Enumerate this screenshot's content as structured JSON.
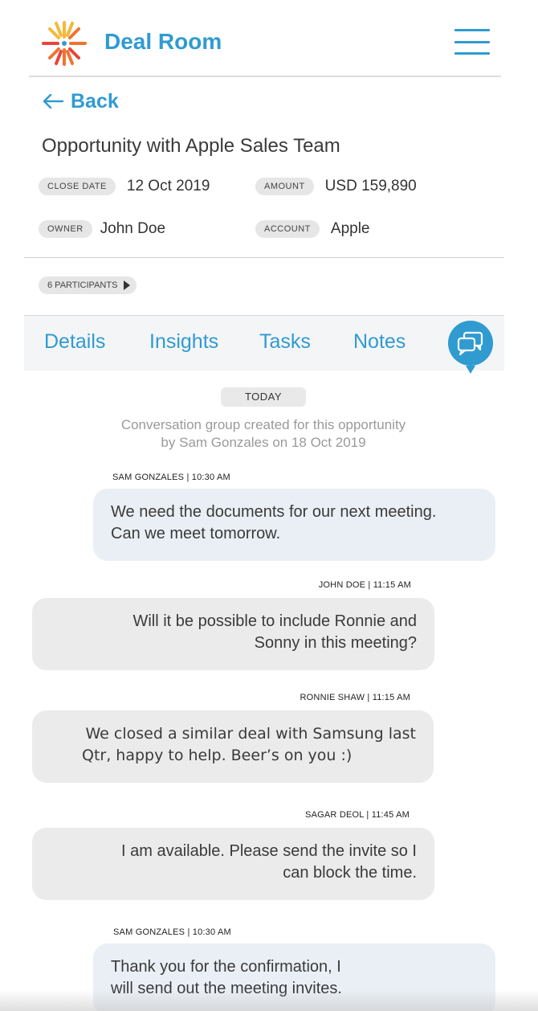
{
  "header": {
    "app_title": "Deal Room"
  },
  "nav": {
    "back_label": "Back"
  },
  "opportunity": {
    "title": "Opportunity with Apple Sales Team",
    "close_date": {
      "label": "CLOSE DATE",
      "value": "12 Oct 2019"
    },
    "amount": {
      "label": "AMOUNT",
      "value": "USD 159,890"
    },
    "owner": {
      "label": "OWNER",
      "value": "John Doe"
    },
    "account": {
      "label": "ACCOUNT",
      "value": "Apple"
    },
    "participants_label": "6 PARTICIPANTS"
  },
  "tabs": [
    {
      "label": "Details"
    },
    {
      "label": "Insights"
    },
    {
      "label": "Tasks"
    },
    {
      "label": "Notes"
    }
  ],
  "chat": {
    "day_label": "TODAY",
    "system_message": {
      "line1": "Conversation group created for this opportunity",
      "line2": "by Sam Gonzales on 18 Oct 2019"
    },
    "messages": [
      {
        "sender": "SAM GONZALES | 10:30 AM",
        "line1": "We need the documents for our next meeting.",
        "line2": "Can we meet tomorrow.",
        "direction": "out"
      },
      {
        "sender": "JOHN DOE | 11:15 AM",
        "line1": "Will it be possible to include Ronnie and",
        "line2": "Sonny in this meeting?",
        "direction": "in"
      },
      {
        "sender": "RONNIE SHAW | 11:15 AM",
        "line1": "We closed a similar deal with Samsung last",
        "line2": "Qtr, happy to help. Beer’s on you :)",
        "direction": "in"
      },
      {
        "sender": "SAGAR DEOL | 11:45 AM",
        "line1": "I am available. Please send the invite so I",
        "line2": "can block the time.",
        "direction": "in"
      },
      {
        "sender": "SAM GONZALES | 10:30 AM",
        "line1": "Thank you for the confirmation, I",
        "line2": "will send out the meeting invites.",
        "direction": "out"
      }
    ]
  },
  "colors": {
    "accent": "#2f9bd1",
    "logo_orange": "#f0742f",
    "logo_yellow": "#f5b83a",
    "logo_red": "#e8453c"
  },
  "icons": [
    "logo-icon",
    "hamburger-menu-icon",
    "back-arrow-icon",
    "chat-bubbles-icon",
    "caret-right-icon"
  ]
}
